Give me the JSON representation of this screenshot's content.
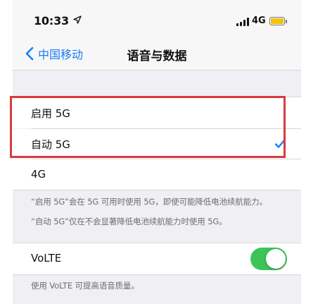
{
  "status_bar": {
    "time": "10:33",
    "network": "4G",
    "location_icon": "location-arrow-icon",
    "battery_color": "#f4c20d"
  },
  "nav": {
    "back_label": "中国移动",
    "title": "语音与数据"
  },
  "options": [
    {
      "label": "启用 5G",
      "selected": false
    },
    {
      "label": "自动 5G",
      "selected": true
    },
    {
      "label": "4G",
      "selected": false
    }
  ],
  "options_footer": [
    "“启用 5G”会在 5G 可用时使用 5G，即使可能降低电池续航能力。",
    "“自动 5G”仅在不会显著降低电池续航能力时使用 5G。"
  ],
  "volte": {
    "label": "VoLTE",
    "enabled": true,
    "footer": "使用 VoLTE 可提高语音质量。"
  },
  "colors": {
    "accent": "#1a7cf5",
    "toggle_on": "#3cc45a",
    "highlight": "#d93a3f"
  }
}
